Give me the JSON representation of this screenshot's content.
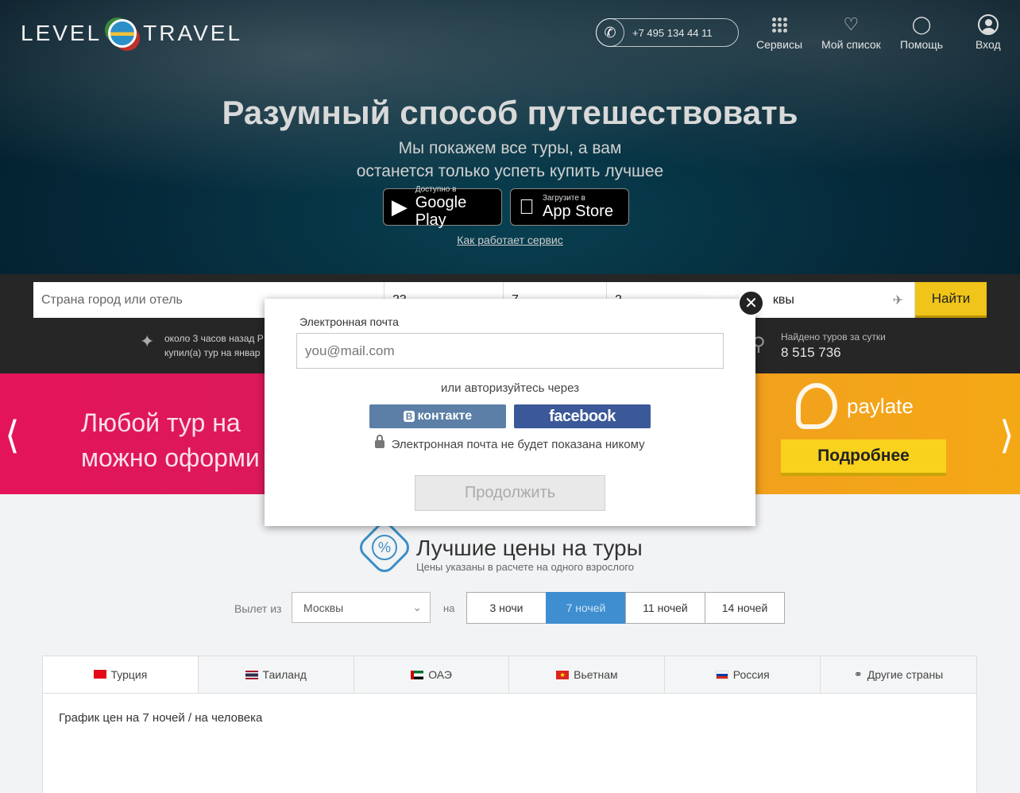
{
  "header": {
    "logo_left": "LEVEL",
    "logo_right": "TRAVEL",
    "phone": "+7 495 134 44 11",
    "nav": [
      {
        "label": "Сервисы",
        "icon": "grid-icon"
      },
      {
        "label": "Мой список",
        "icon": "heart-icon"
      },
      {
        "label": "Помощь",
        "icon": "bulb-icon"
      },
      {
        "label": "Вход",
        "icon": "user-icon"
      }
    ]
  },
  "hero": {
    "title": "Разумный способ путешествовать",
    "subtitle_line1": "Мы покажем все туры, а вам",
    "subtitle_line2": "останется только успеть купить лучшее",
    "google_small": "Доступно в",
    "google_big": "Google Play",
    "apple_small": "Загрузите в",
    "apple_big": "App Store",
    "how_link": "Как работает сервис"
  },
  "search": {
    "destination_placeholder": "Страна город или отель",
    "date_value": "23",
    "nights_value": "7",
    "guests_value": "2",
    "from_value": "квы",
    "find_label": "Найти",
    "recent_line1": "около 3 часов назад Р",
    "recent_line2": "купил(а) тур на январ",
    "found_label": "Найдено туров за сутки",
    "found_count": "8 515 736"
  },
  "banner": {
    "line1": "Любой тур на",
    "line2": "можно оформи",
    "brand": "paylate",
    "more_label": "Подробнее"
  },
  "best_prices": {
    "title": "Лучшие цены на туры",
    "subtitle": "Цены указаны в расчете на одного взрослого",
    "departure_label": "Вылет из",
    "departure_value": "Москвы",
    "on_label": "на",
    "nights": [
      "3 ночи",
      "7 ночей",
      "11 ночей",
      "14 ночей"
    ],
    "active_night": "7 ночей",
    "countries": [
      "Турция",
      "Таиланд",
      "ОАЭ",
      "Вьетнам",
      "Россия",
      "Другие страны"
    ],
    "chart_caption": "График цен на 7 ночей / на человека"
  },
  "modal": {
    "close_label": "закрыть",
    "email_label": "Электронная почта",
    "email_placeholder": "you@mail.com",
    "or_label": "или авторизуйтесь через",
    "vk_label": "контакте",
    "vk_mark": "В",
    "fb_label": "facebook",
    "privacy": "Электронная почта не будет показана никому",
    "continue_label": "Продолжить"
  },
  "colors": {
    "accent_yellow": "#f0c419",
    "accent_blue": "#3e8ed0",
    "vk_blue": "#5b7fa6",
    "fb_blue": "#3b5998"
  }
}
